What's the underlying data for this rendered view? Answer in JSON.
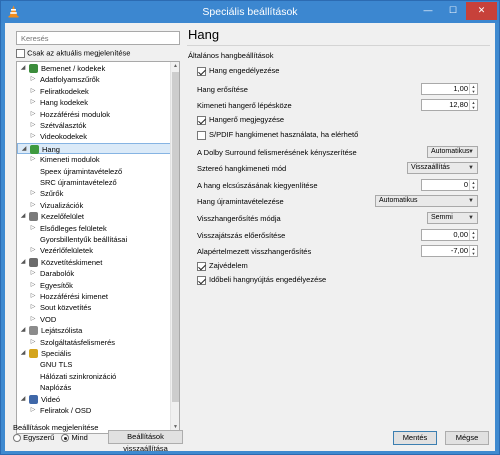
{
  "window": {
    "title": "Speciális beállítások",
    "min_glyph": "—",
    "max_glyph": "☐",
    "close_glyph": "✕"
  },
  "search": {
    "placeholder": "Keresés"
  },
  "only_current": {
    "label": "Csak az aktuális megjelenítése",
    "checked": false
  },
  "tree": [
    {
      "label": "Bemenet / kodekek",
      "level": 0,
      "expanded": true,
      "icon": "input-codecs-icon"
    },
    {
      "label": "Adatfolyamszűrők",
      "level": 1
    },
    {
      "label": "Feliratkodekek",
      "level": 1
    },
    {
      "label": "Hang kodekek",
      "level": 1
    },
    {
      "label": "Hozzáférési modulok",
      "level": 1
    },
    {
      "label": "Szétválasztók",
      "level": 1
    },
    {
      "label": "Videokodekek",
      "level": 1
    },
    {
      "label": "Hang",
      "level": 0,
      "expanded": true,
      "selected": true,
      "icon": "audio-icon"
    },
    {
      "label": "Kimeneti modulok",
      "level": 1
    },
    {
      "label": "Speex újramintavételező",
      "level": 1,
      "leaf": true
    },
    {
      "label": "SRC újramintavételező",
      "level": 1,
      "leaf": true
    },
    {
      "label": "Szűrők",
      "level": 1
    },
    {
      "label": "Vizualizációk",
      "level": 1
    },
    {
      "label": "Kezelőfelület",
      "level": 0,
      "expanded": true,
      "icon": "interface-icon"
    },
    {
      "label": "Elsődleges felületek",
      "level": 1
    },
    {
      "label": "Gyorsbillentyűk beállításai",
      "level": 1,
      "leaf": true
    },
    {
      "label": "Vezérlőfelületek",
      "level": 1
    },
    {
      "label": "Közvetítéskimenet",
      "level": 0,
      "expanded": true,
      "icon": "stream-output-icon"
    },
    {
      "label": "Darabolók",
      "level": 1
    },
    {
      "label": "Egyesítők",
      "level": 1
    },
    {
      "label": "Hozzáférési kimenet",
      "level": 1
    },
    {
      "label": "Sout közvetítés",
      "level": 1
    },
    {
      "label": "VOD",
      "level": 1
    },
    {
      "label": "Lejátszólista",
      "level": 0,
      "expanded": true,
      "icon": "playlist-icon"
    },
    {
      "label": "Szolgáltatásfelismerés",
      "level": 1
    },
    {
      "label": "Speciális",
      "level": 0,
      "expanded": true,
      "icon": "advanced-icon"
    },
    {
      "label": "GNU TLS",
      "level": 1,
      "leaf": true
    },
    {
      "label": "Hálózati szinkronizáció",
      "level": 1,
      "leaf": true
    },
    {
      "label": "Naplózás",
      "level": 1,
      "leaf": true
    },
    {
      "label": "Videó",
      "level": 0,
      "expanded": true,
      "icon": "video-icon"
    },
    {
      "label": "Feliratok / OSD",
      "level": 1
    }
  ],
  "panel": {
    "title": "Hang",
    "section": "Általános hangbeállítások",
    "enable_audio": {
      "label": "Hang engedélyezése",
      "checked": true
    },
    "gain": {
      "label": "Hang erősítése",
      "value": "1,00"
    },
    "volume_step": {
      "label": "Kimeneti hangerő lépésköze",
      "value": "12,80"
    },
    "remember_volume": {
      "label": "Hangerő megjegyzése",
      "checked": true
    },
    "spdif": {
      "label": "S/PDIF hangkimenet használata, ha elérhető",
      "checked": false
    },
    "dolby": {
      "label": "A Dolby Surround felismerésének kényszerítése",
      "value": "Automatikus"
    },
    "stereo": {
      "label": "Sztereó hangkimeneti mód",
      "value": "Visszaállítás"
    },
    "desync": {
      "label": "A hang elcsúszásának kiegyenlítése",
      "value": "0"
    },
    "resampler": {
      "label": "Hang újramintavételezése",
      "value": "Automatikus"
    },
    "replaygain_mode": {
      "label": "Visszhangerősítés módja",
      "value": "Semmi"
    },
    "replay_preamp": {
      "label": "Visszajátszás előerősítése",
      "value": "0,00"
    },
    "default_replaygain": {
      "label": "Alapértelmezett visszhangerősítés",
      "value": "-7,00"
    },
    "protection": {
      "label": "Zajvédelem",
      "checked": true
    },
    "time_stretch": {
      "label": "Időbeli hangnyújtás engedélyezése",
      "checked": true
    }
  },
  "footer": {
    "show_label": "Beállítások megjelenítése",
    "simple": "Egyszerű",
    "all": "Mind",
    "all_selected": true,
    "reset": "Beállítások visszaállítása",
    "save": "Mentés",
    "cancel": "Mégse"
  }
}
